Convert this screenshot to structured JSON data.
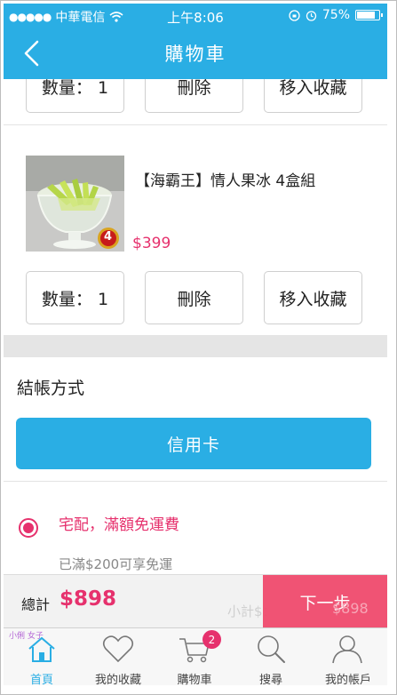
{
  "status_bar": {
    "carrier": "中華電信",
    "time": "上午8:06",
    "battery": "75%"
  },
  "nav": {
    "title": "購物車"
  },
  "cart": {
    "item_prev_actions": {
      "quantity": "數量： 1",
      "delete": "刪除",
      "favorite": "移入收藏"
    },
    "item": {
      "name": "【海霸王】情人果冰 4盒組",
      "price": "$399",
      "image_badge": "4",
      "quantity": "數量： 1",
      "delete": "刪除",
      "favorite": "移入收藏"
    }
  },
  "payment": {
    "section_title": "結帳方式",
    "method_button": "信用卡"
  },
  "shipping": {
    "title": "宅配，滿額免運費",
    "note": "已滿$200可享免運"
  },
  "checkout": {
    "total_label": "總計",
    "total_value": "$898",
    "subtotal_label_faded": "小計$：",
    "subtotal_value_faded": "$898",
    "next_button": "下一步"
  },
  "tabbar": {
    "watermark": "小俐 女子",
    "items": [
      {
        "label": "首頁",
        "icon": "home-icon"
      },
      {
        "label": "我的收藏",
        "icon": "heart-icon"
      },
      {
        "label": "購物車",
        "icon": "cart-icon",
        "badge": "2"
      },
      {
        "label": "搜尋",
        "icon": "search-icon"
      },
      {
        "label": "我的帳戶",
        "icon": "user-icon"
      }
    ]
  },
  "colors": {
    "brand_blue": "#2aaee4",
    "accent_pink": "#e6316d",
    "next_button": "#f04b6e"
  }
}
